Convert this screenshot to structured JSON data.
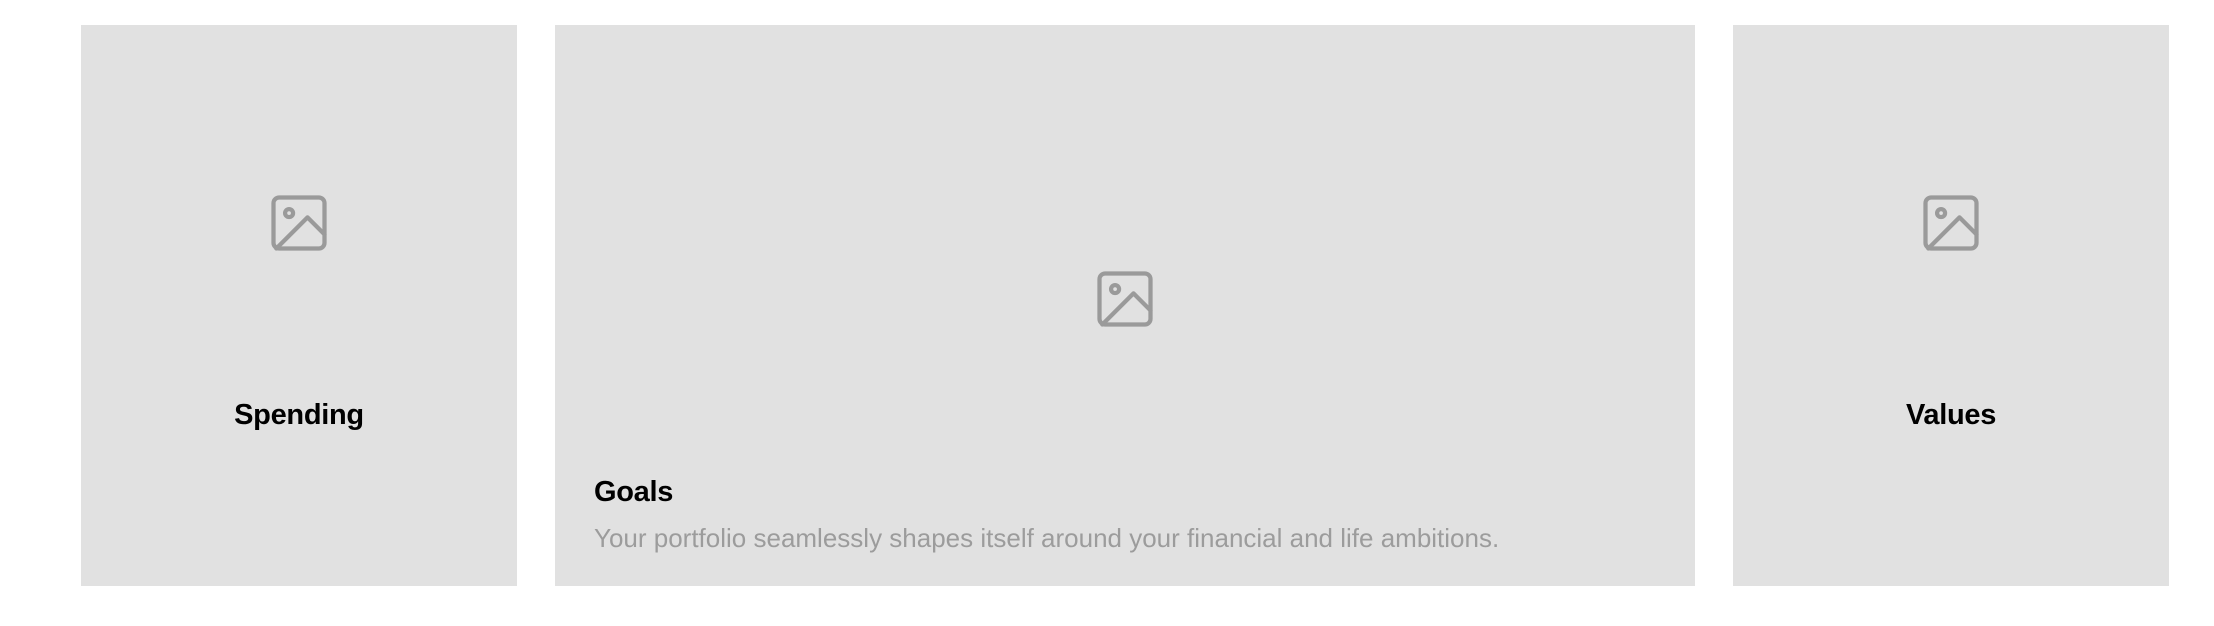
{
  "cards": [
    {
      "title": "Spending",
      "icon": "image-placeholder-icon"
    },
    {
      "title": "Goals",
      "description": "Your portfolio seamlessly shapes itself around your financial and life ambitions.",
      "icon": "image-placeholder-icon"
    },
    {
      "title": "Values",
      "icon": "image-placeholder-icon"
    }
  ],
  "colors": {
    "card_background": "#e1e1e1",
    "icon": "#9a9a9a",
    "title": "#000000",
    "description": "#9c9c9c"
  }
}
